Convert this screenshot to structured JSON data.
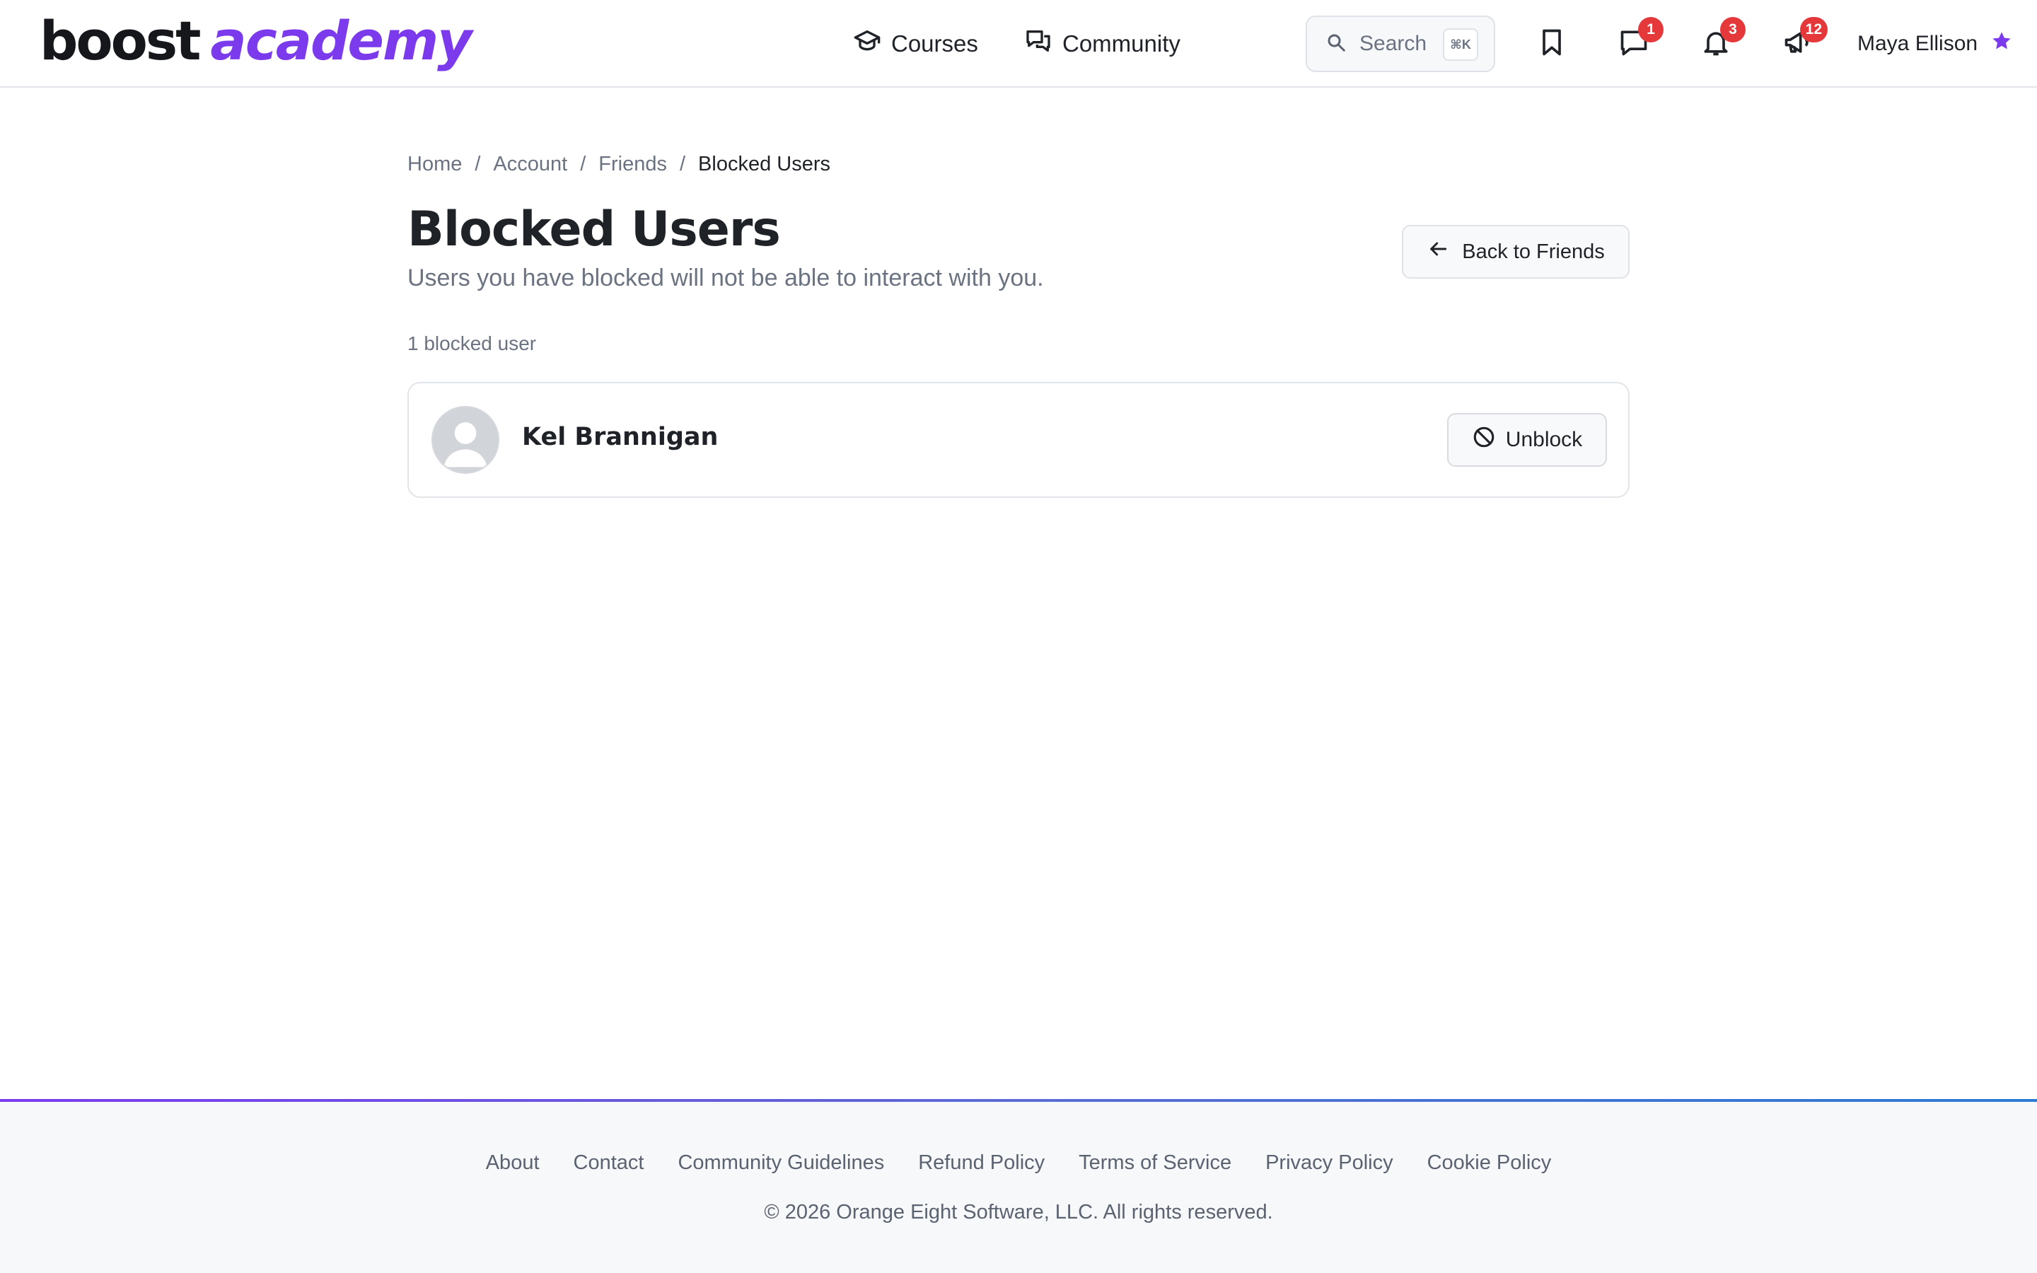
{
  "header": {
    "logo": {
      "part1": "boost",
      "part2": "academy"
    },
    "nav": [
      {
        "label": "Courses",
        "icon": "graduation-cap-icon"
      },
      {
        "label": "Community",
        "icon": "chat-bubbles-icon"
      }
    ],
    "search": {
      "placeholder": "Search",
      "shortcut": "⌘K"
    },
    "icons": {
      "bookmarks": {
        "icon": "bookmark-icon"
      },
      "messages": {
        "icon": "message-icon",
        "badge": "1"
      },
      "notifications": {
        "icon": "bell-icon",
        "badge": "3"
      },
      "announcements": {
        "icon": "megaphone-icon",
        "badge": "12"
      }
    },
    "user": {
      "name": "Maya Ellison",
      "icon": "star-icon"
    },
    "colors": {
      "brand": "#7c3aed",
      "badge": "#e5383b"
    }
  },
  "breadcrumb": {
    "items": [
      "Home",
      "Account",
      "Friends"
    ],
    "current": "Blocked Users",
    "separator": "/"
  },
  "page": {
    "title": "Blocked Users",
    "subtitle": "Users you have blocked will not be able to interact with you.",
    "back_button": "Back to Friends",
    "count_text": "1 blocked user"
  },
  "blocked_users": [
    {
      "name": "Kel Brannigan",
      "action": "Unblock"
    }
  ],
  "footer": {
    "links": [
      "About",
      "Contact",
      "Community Guidelines",
      "Refund Policy",
      "Terms of Service",
      "Privacy Policy",
      "Cookie Policy"
    ],
    "copyright": "© 2026 Orange Eight Software, LLC. All rights reserved."
  }
}
